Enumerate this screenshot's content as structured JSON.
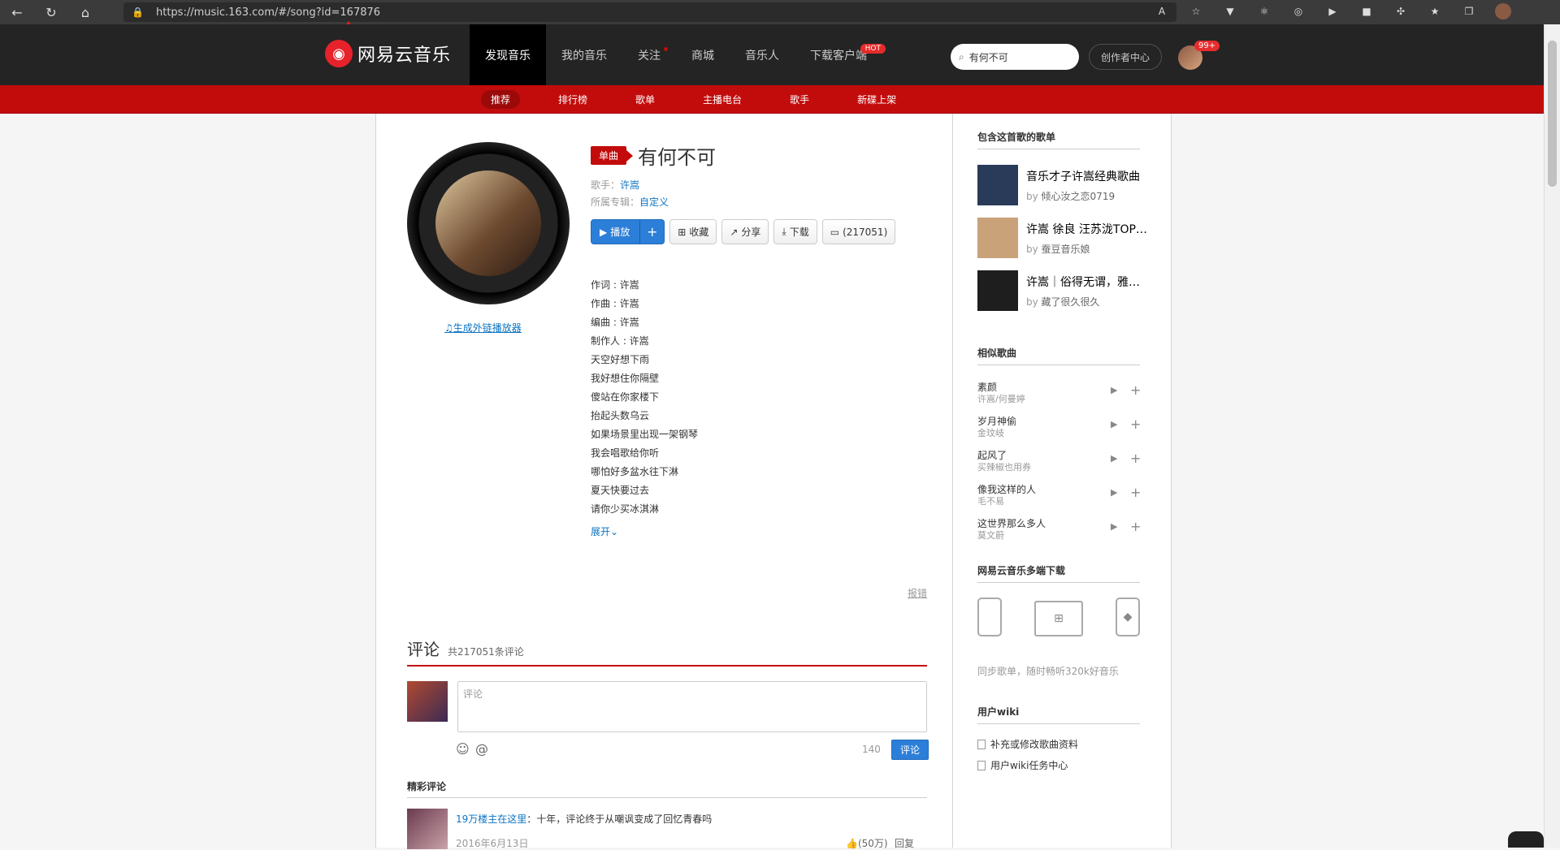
{
  "browser": {
    "url": "https://music.163.com/#/song?id=167876"
  },
  "header": {
    "logo_text": "网易云音乐",
    "nav": [
      "发现音乐",
      "我的音乐",
      "关注",
      "商城",
      "音乐人",
      "下载客户端"
    ],
    "hot_badge": "HOT",
    "search_value": "有何不可",
    "creator_center": "创作者中心",
    "msg_count": "99+"
  },
  "subnav": [
    "推荐",
    "排行榜",
    "歌单",
    "主播电台",
    "歌手",
    "新碟上架"
  ],
  "song": {
    "tag": "单曲",
    "title": "有何不可",
    "singer_label": "歌手：",
    "singer": "许嵩",
    "album_label": "所属专辑：",
    "album": "自定义",
    "gen_player_link": "生成外链播放器",
    "play_label": "播放",
    "add_label": "+",
    "collect_label": "收藏",
    "share_label": "分享",
    "download_label": "下载",
    "comment_btn_label": "(217051)",
    "lyrics": [
      "作词 : 许嵩",
      "作曲 : 许嵩",
      "编曲 : 许嵩",
      "制作人 : 许嵩",
      "天空好想下雨",
      "我好想住你隔壁",
      "傻站在你家楼下",
      "抬起头数乌云",
      "如果场景里出现一架钢琴",
      "我会唱歌给你听",
      "哪怕好多盆水往下淋",
      "夏天快要过去",
      "请你少买冰淇淋"
    ],
    "expand_label": "展开",
    "report_label": "报错"
  },
  "comments": {
    "title": "评论",
    "count_label": "共217051条评论",
    "placeholder": "评论",
    "char_count": "140",
    "submit_label": "评论",
    "hot_title": "精彩评论",
    "hot": [
      {
        "user": "19万楼主在这里",
        "text": "：十年，评论终于从嘲讽变成了回忆青春吗",
        "date": "2016年6月13日",
        "likes": "(50万)",
        "reply": "回复"
      }
    ]
  },
  "sidebar": {
    "playlists_title": "包含这首歌的歌单",
    "playlists": [
      {
        "name": "音乐才子许嵩经典歌曲",
        "by": "by",
        "author": "倾心汝之恋0719",
        "color": "#2a3b5a"
      },
      {
        "name": "许嵩 徐良 汪苏泷TOP串烧",
        "by": "by",
        "author": "蚕豆音乐娘",
        "color": "#c9a27a"
      },
      {
        "name": "许嵩｜俗得无谓，雅得绝对",
        "by": "by",
        "author": "藏了很久很久",
        "color": "#1e1e1e"
      }
    ],
    "similar_title": "相似歌曲",
    "similar": [
      {
        "name": "素颜",
        "artist": "许嵩/何曼婷"
      },
      {
        "name": "岁月神偷",
        "artist": "金玟岐"
      },
      {
        "name": "起风了",
        "artist": "买辣椒也用券"
      },
      {
        "name": "像我这样的人",
        "artist": "毛不易"
      },
      {
        "name": "这世界那么多人",
        "artist": "莫文蔚"
      }
    ],
    "download_title": "网易云音乐多端下载",
    "download_desc": "同步歌单，随时畅听320k好音乐",
    "wiki_title": "用户wiki",
    "wiki_items": [
      "补充或修改歌曲资料",
      "用户wiki任务中心"
    ]
  }
}
